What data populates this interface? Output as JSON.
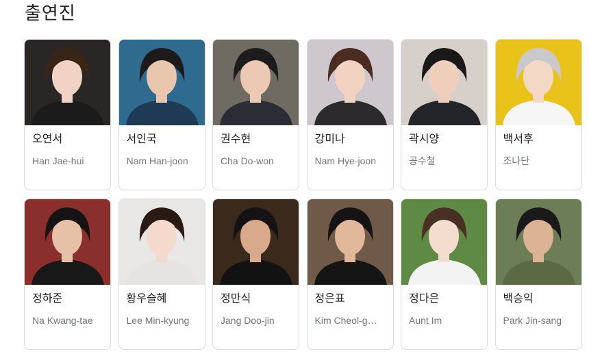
{
  "section": {
    "title": "출연진"
  },
  "cast": [
    {
      "name": "오연서",
      "role": "Han Jae-hui",
      "bg": "#2b2626",
      "skin": "#f1d3c4",
      "hair": "#3a2418",
      "cloth": "#1b1b1b",
      "icon": "actor-photo"
    },
    {
      "name": "서인국",
      "role": "Nam Han-joon",
      "bg": "#2f6a8f",
      "skin": "#e9c6ae",
      "hair": "#1c1a1a",
      "cloth": "#1f3a54",
      "icon": "actor-photo"
    },
    {
      "name": "권수현",
      "role": "Cha Do-won",
      "bg": "#6f6a62",
      "skin": "#ecc9b2",
      "hair": "#1d1c1c",
      "cloth": "#2a2d33",
      "icon": "actor-photo"
    },
    {
      "name": "강미나",
      "role": "Nam Hye-joon",
      "bg": "#cfc7ce",
      "skin": "#f2d2c0",
      "hair": "#4a2c20",
      "cloth": "#2c2a2f",
      "icon": "actor-photo"
    },
    {
      "name": "곽시양",
      "role": "공수철",
      "bg": "#d7cfc9",
      "skin": "#efcfbb",
      "hair": "#1a1818",
      "cloth": "#23252b",
      "icon": "actor-photo"
    },
    {
      "name": "백서후",
      "role": "조나단",
      "bg": "#e9c21a",
      "skin": "#f3d8c6",
      "hair": "#c9c9cc",
      "cloth": "#f6f6f6",
      "icon": "actor-photo"
    },
    {
      "name": "정하준",
      "role": "Na Kwang-tae",
      "bg": "#8a2f2b",
      "skin": "#e6c1a8",
      "hair": "#151313",
      "cloth": "#181818",
      "icon": "actor-photo"
    },
    {
      "name": "황우슬혜",
      "role": "Lee Min-kyung",
      "bg": "#e9e6e6",
      "skin": "#f4d9cc",
      "hair": "#2a1a14",
      "cloth": "#e8e3e3",
      "icon": "actor-photo"
    },
    {
      "name": "정만식",
      "role": "Jang Doo-jin",
      "bg": "#3a2a1c",
      "skin": "#d9a98c",
      "hair": "#141212",
      "cloth": "#121212",
      "icon": "actor-photo"
    },
    {
      "name": "정은표",
      "role": "Kim Cheol-g…",
      "bg": "#6e5a46",
      "skin": "#e3b89a",
      "hair": "#151313",
      "cloth": "#141414",
      "icon": "actor-photo"
    },
    {
      "name": "정다은",
      "role": "Aunt Im",
      "bg": "#5f8a43",
      "skin": "#f4dccf",
      "hair": "#4a2f24",
      "cloth": "#f3f3f3",
      "icon": "actor-photo"
    },
    {
      "name": "백승익",
      "role": "Park Jin-sang",
      "bg": "#6d7d55",
      "skin": "#dcb394",
      "hair": "#1a1a1a",
      "cloth": "#5c6a44",
      "icon": "actor-photo"
    }
  ]
}
